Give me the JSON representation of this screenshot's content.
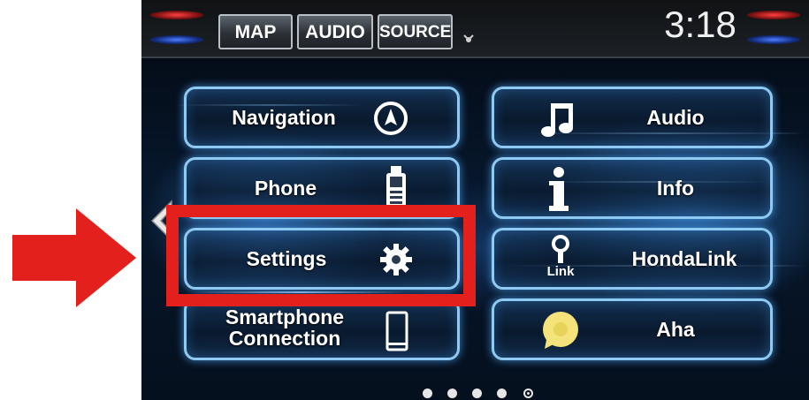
{
  "topbar": {
    "tabs": [
      "MAP",
      "AUDIO",
      "SOURCE"
    ],
    "time": "3:18"
  },
  "home_menu": {
    "left_items": [
      "Navigation",
      "Phone",
      "Settings",
      "Smartphone\nConnection"
    ],
    "right_items": [
      "Audio",
      "Info",
      "HondaLink",
      "Aha"
    ],
    "link_icon_text": "Link"
  },
  "page_indicator": {
    "pages": 5,
    "current": 5
  },
  "colors": {
    "tile_border": "#8ecaf2",
    "highlight_box": "#e3201b",
    "arrow": "#e3201b",
    "aha_icon": "#f3e37a"
  },
  "icons": [
    "compass-icon",
    "cellphone-icon",
    "gear-icon",
    "smartphone-icon",
    "music-note-icon",
    "info-icon",
    "hondalink-icon",
    "aha-icon",
    "gps-signal-icon",
    "back-arrow-icon"
  ]
}
